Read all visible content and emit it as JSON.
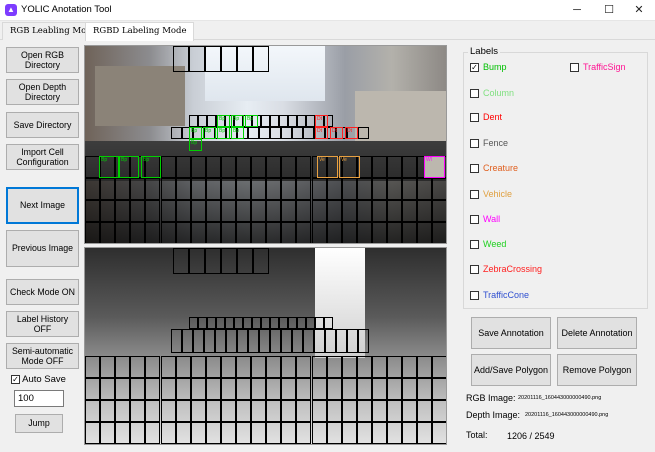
{
  "window": {
    "title": "YOLIC Anotation Tool",
    "app_icon": "app-logo-icon"
  },
  "window_controls": {
    "minimize": "─",
    "maximize": "☐",
    "close": "✕"
  },
  "tabs": [
    {
      "label": "RGB Leabling Mode"
    },
    {
      "label": "RGBD Labeling Mode"
    }
  ],
  "left_panel": {
    "open_rgb": "Open RGB Directory",
    "open_depth": "Open Depth Directory",
    "save_dir": "Save Directory",
    "import_cell": "Import Cell Configuration",
    "next_image": "Next Image",
    "previous_image": "Previous Image",
    "check_mode": "Check Mode ON",
    "label_history": "Label History OFF",
    "semi_auto": "Semi-automatic Mode OFF",
    "auto_save": "Auto Save",
    "auto_save_checked": true,
    "jump_value": "100",
    "jump": "Jump"
  },
  "labels_panel": {
    "title": "Labels",
    "items": [
      {
        "name": "Bump",
        "color": "#00c000",
        "checked": true
      },
      {
        "name": "TrafficSign",
        "color": "#ff1493",
        "checked": false
      },
      {
        "name": "Column",
        "color": "#80e080",
        "checked": false
      },
      {
        "name": "Dent",
        "color": "#ff0000",
        "checked": false
      },
      {
        "name": "Fence",
        "color": "#555555",
        "checked": false
      },
      {
        "name": "Creature",
        "color": "#e06020",
        "checked": false
      },
      {
        "name": "Vehicle",
        "color": "#e0a040",
        "checked": false
      },
      {
        "name": "Wall",
        "color": "#ff00ff",
        "checked": false
      },
      {
        "name": "Weed",
        "color": "#20d020",
        "checked": false
      },
      {
        "name": "ZebraCrossing",
        "color": "#ff2020",
        "checked": false
      },
      {
        "name": "TrafficCone",
        "color": "#3050d0",
        "checked": false
      }
    ]
  },
  "right_panel": {
    "save_annotation": "Save Annotation",
    "delete_annotation": "Delete Annotation",
    "add_save_polygon": "Add/Save Polygon",
    "remove_polygon": "Remove Polygon",
    "rgb_image_label": "RGB Image:",
    "rgb_image_file": "20201116_160443000000490.png",
    "depth_image_label": "Depth Image:",
    "depth_image_file": "20201116_160443000000490.png",
    "total_label": "Total:",
    "total_value": "1206 / 2549"
  },
  "cell_tags": {
    "bump": "Bp",
    "dent": "Dt",
    "vehicle": "Ve",
    "wall": "Wl"
  }
}
